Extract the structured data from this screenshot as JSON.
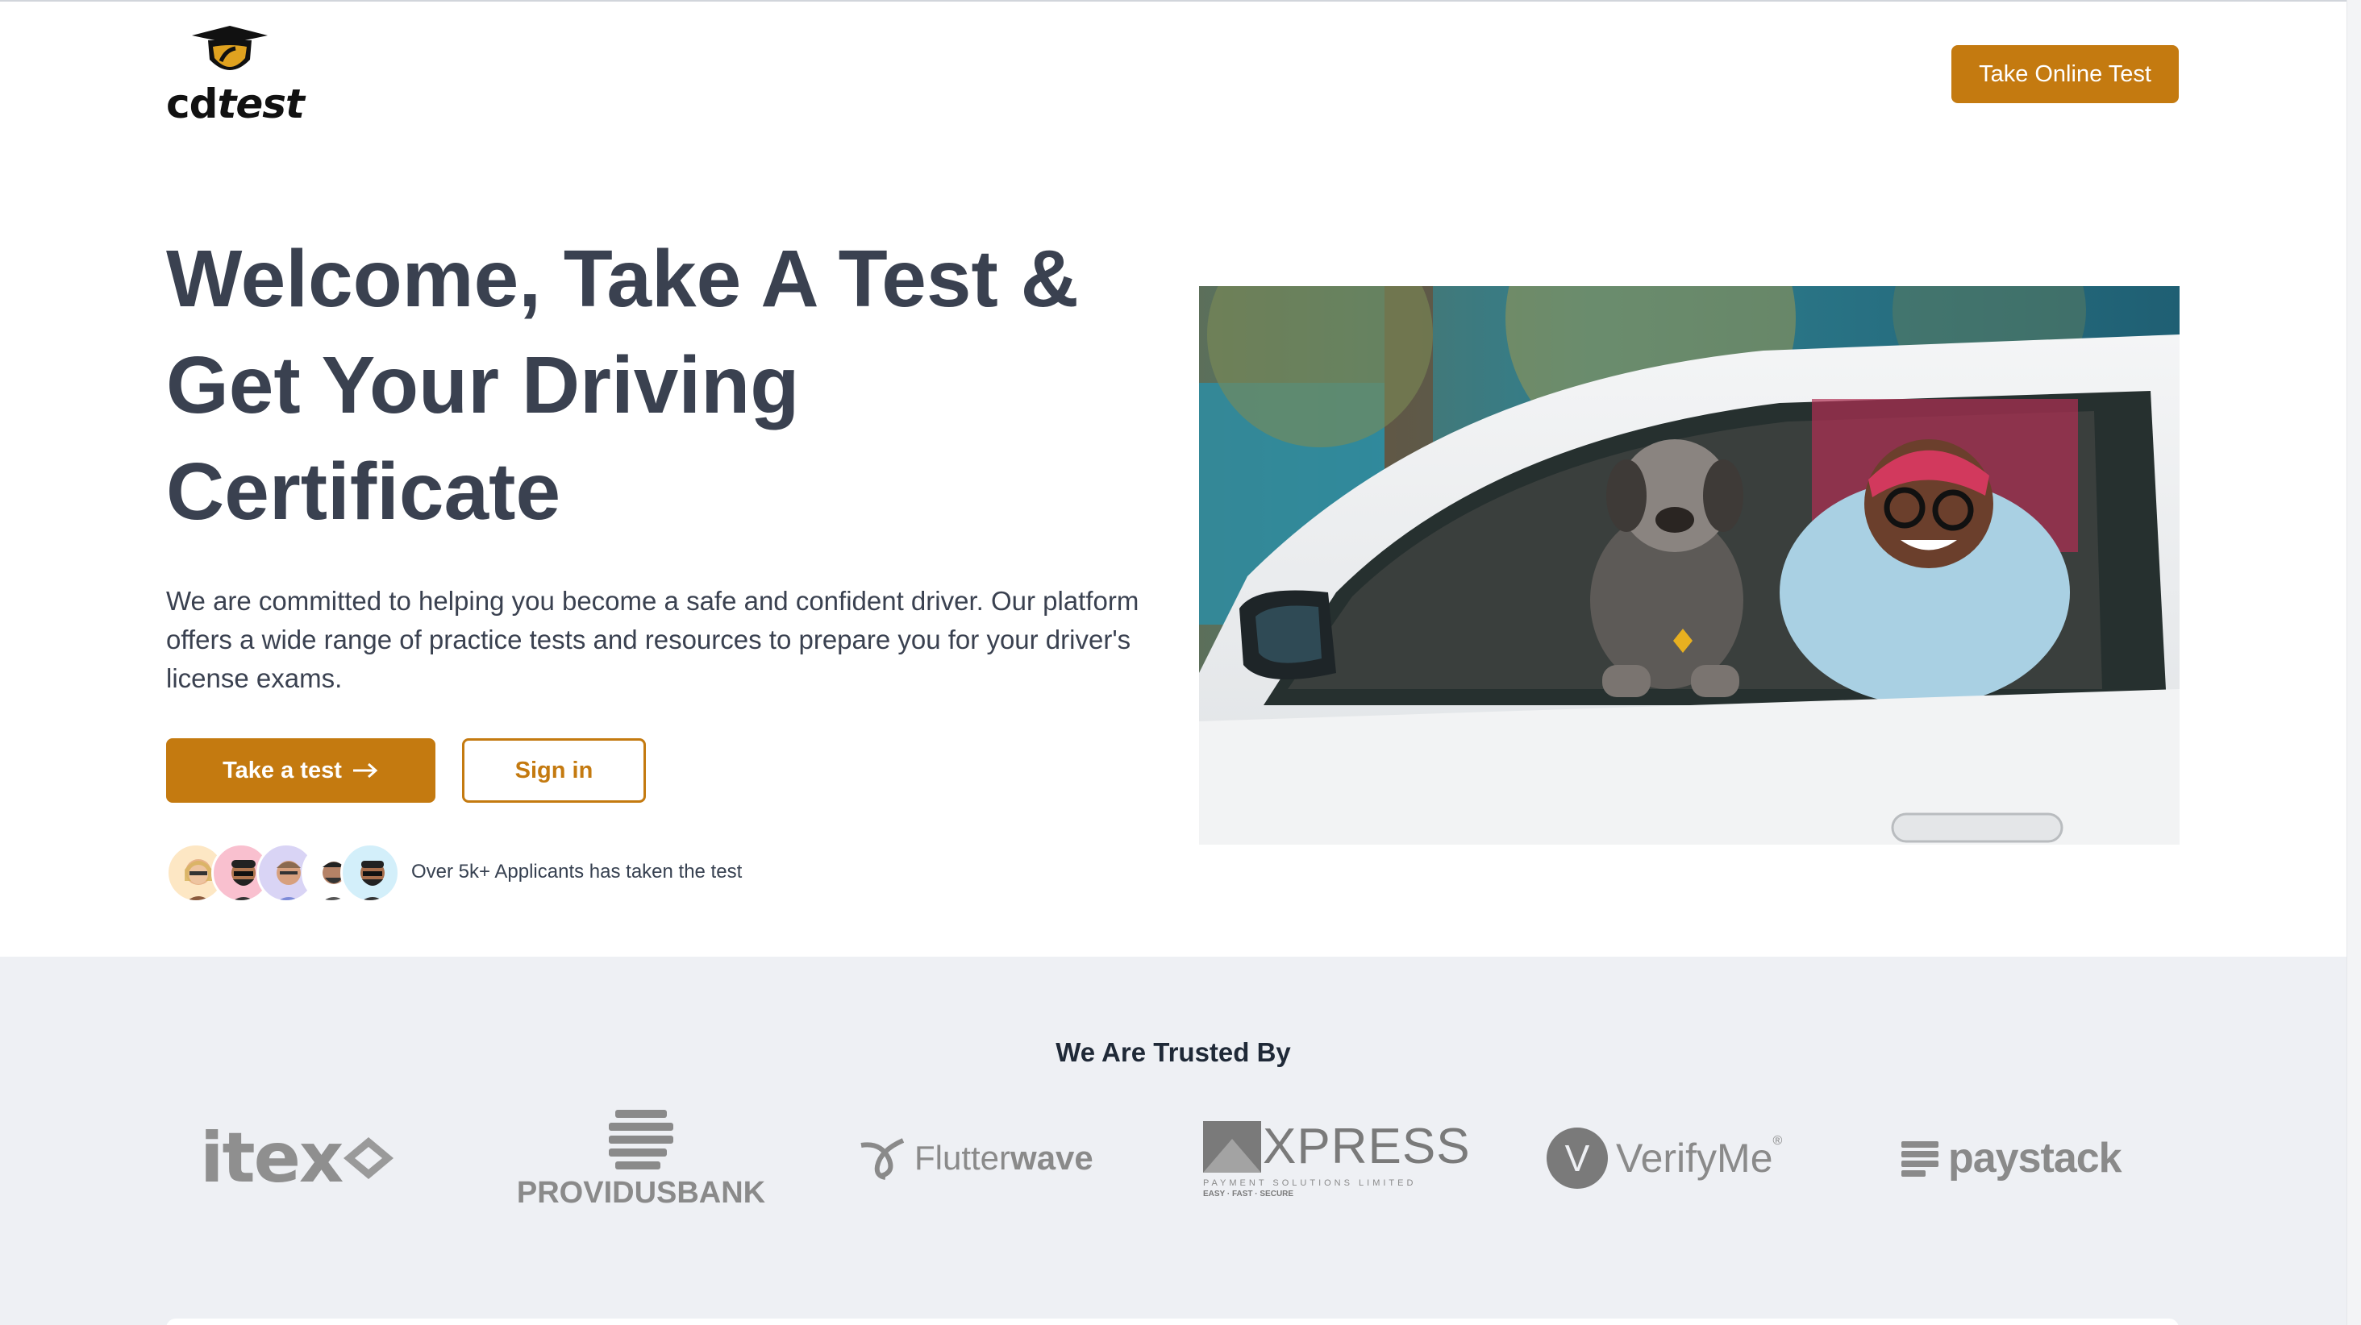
{
  "header": {
    "logo_text_bold": "cd",
    "logo_text_italic": "test",
    "cta_label": "Take Online Test"
  },
  "hero": {
    "title": "Welcome, Take A Test & Get Your Driving Certificate",
    "description": "We are committed to helping you become a safe and confident driver. Our platform offers a wide range of practice tests and resources to prepare you for your driver's license exams.",
    "primary_button": "Take a test",
    "primary_button_icon": "arrow-right-icon",
    "secondary_button": "Sign in",
    "applicants_text": "Over 5k+ Applicants has taken the test"
  },
  "trusted": {
    "title": "We Are Trusted By",
    "logos": {
      "itex": "itex",
      "providus": "PROVIDUSBANK",
      "flutter_light": "Flutter",
      "flutter_bold": "wave",
      "xpress": "XPRESS",
      "xpress_sub": "PAYMENT SOLUTIONS LIMITED",
      "xpress_tag": "EASY · FAST · SECURE",
      "verifyme_letter": "V",
      "verifyme": "VerifyMe",
      "verifyme_reg": "®",
      "paystack": "paystack"
    }
  },
  "colors": {
    "accent": "#c47a10",
    "heading": "#3a4150",
    "band": "#eef0f4"
  }
}
